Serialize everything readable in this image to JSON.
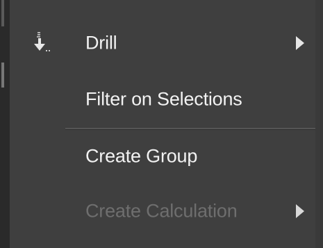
{
  "menu": {
    "items": [
      {
        "label": "Drill",
        "icon": "drill-down-icon",
        "has_submenu": true,
        "enabled": true
      },
      {
        "label": "Filter on Selections",
        "has_submenu": false,
        "enabled": true
      },
      {
        "label": "Create Group",
        "has_submenu": false,
        "enabled": true
      },
      {
        "label": "Create Calculation",
        "has_submenu": true,
        "enabled": false
      }
    ]
  },
  "colors": {
    "menu_background": "#3f3f3f",
    "text_enabled": "#f2f2f2",
    "text_disabled": "#6e6e6e",
    "separator": "#555555"
  }
}
